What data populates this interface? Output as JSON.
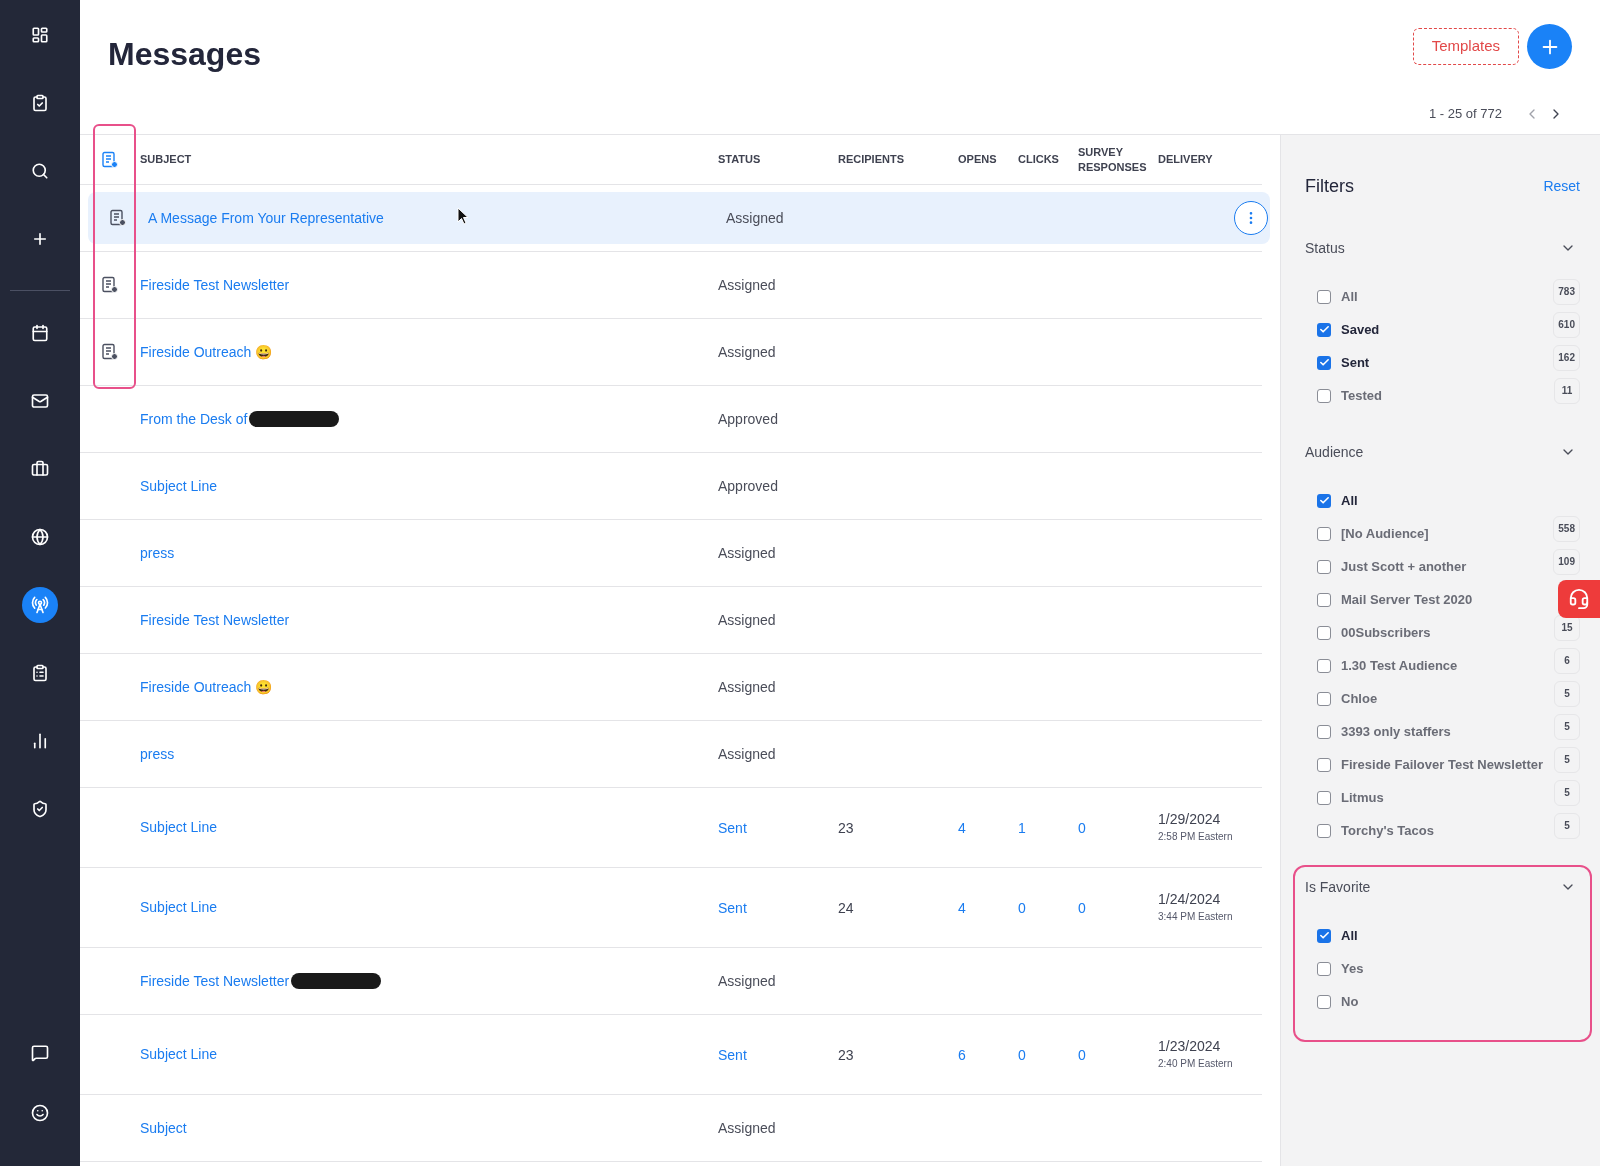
{
  "nav": [
    {
      "selected": false
    },
    {
      "selected": false
    },
    {
      "selected": false
    },
    {
      "selected": false
    },
    {
      "selected": false
    },
    {
      "selected": false
    },
    {
      "selected": false
    },
    {
      "selected": false
    },
    {
      "selected": true
    },
    {
      "selected": false
    },
    {
      "selected": false
    },
    {
      "selected": false
    },
    {
      "selected": false
    },
    {
      "selected": false
    }
  ],
  "header": {
    "title": "Messages",
    "templates_button": "Templates",
    "pagination": "1 - 25 of 772"
  },
  "table": {
    "columns": [
      "SUBJECT",
      "STATUS",
      "RECIPIENTS",
      "OPENS",
      "CLICKS",
      "SURVEY RESPONSES",
      "DELIVERY"
    ],
    "rows": [
      {
        "icon": true,
        "highlighted": true,
        "subject": "A Message From Your Representative",
        "redacted": false,
        "status": "Assigned",
        "kind": "text"
      },
      {
        "icon": true,
        "highlighted": false,
        "subject": "Fireside Test Newsletter",
        "redacted": false,
        "status": "Assigned",
        "kind": "text"
      },
      {
        "icon": true,
        "highlighted": false,
        "subject": "Fireside Outreach 😀",
        "redacted": false,
        "status": "Assigned",
        "kind": "text"
      },
      {
        "icon": false,
        "highlighted": false,
        "subject": "From the Desk of",
        "redacted": true,
        "status": "Approved",
        "kind": "text"
      },
      {
        "icon": false,
        "highlighted": false,
        "subject": "Subject Line",
        "redacted": false,
        "status": "Approved",
        "kind": "text"
      },
      {
        "icon": false,
        "highlighted": false,
        "subject": "press",
        "redacted": false,
        "status": "Assigned",
        "kind": "text"
      },
      {
        "icon": false,
        "highlighted": false,
        "subject": "Fireside Test Newsletter",
        "redacted": false,
        "status": "Assigned",
        "kind": "text"
      },
      {
        "icon": false,
        "highlighted": false,
        "subject": "Fireside Outreach 😀",
        "redacted": false,
        "status": "Assigned",
        "kind": "text"
      },
      {
        "icon": false,
        "highlighted": false,
        "subject": "press",
        "redacted": false,
        "status": "Assigned",
        "kind": "text"
      },
      {
        "icon": false,
        "highlighted": false,
        "subject": "Subject Line",
        "redacted": false,
        "status": "Sent",
        "kind": "link",
        "recipients": "23",
        "opens": "4",
        "clicks": "1",
        "survey_responses": "0",
        "delivery_date": "1/29/2024",
        "delivery_time": "2:58 PM Eastern"
      },
      {
        "icon": false,
        "highlighted": false,
        "subject": "Subject Line",
        "redacted": false,
        "status": "Sent",
        "kind": "link",
        "recipients": "24",
        "opens": "4",
        "clicks": "0",
        "survey_responses": "0",
        "delivery_date": "1/24/2024",
        "delivery_time": "3:44 PM Eastern"
      },
      {
        "icon": false,
        "highlighted": false,
        "subject": "Fireside Test Newsletter",
        "redacted": true,
        "status": "Assigned",
        "kind": "text"
      },
      {
        "icon": false,
        "highlighted": false,
        "subject": "Subject Line",
        "redacted": false,
        "status": "Sent",
        "kind": "link",
        "recipients": "23",
        "opens": "6",
        "clicks": "0",
        "survey_responses": "0",
        "delivery_date": "1/23/2024",
        "delivery_time": "2:40 PM Eastern"
      },
      {
        "icon": false,
        "highlighted": false,
        "subject": "Subject",
        "redacted": false,
        "status": "Assigned",
        "kind": "text"
      }
    ]
  },
  "filters": {
    "title": "Filters",
    "reset": "Reset",
    "groups": [
      {
        "title": "Status",
        "expanded": true,
        "highlighted": false,
        "options": [
          {
            "label": "All",
            "checked": false,
            "count": "783"
          },
          {
            "label": "Saved",
            "checked": true,
            "count": "610"
          },
          {
            "label": "Sent",
            "checked": true,
            "count": "162"
          },
          {
            "label": "Tested",
            "checked": false,
            "count": "11"
          }
        ]
      },
      {
        "title": "Audience",
        "expanded": true,
        "highlighted": false,
        "options": [
          {
            "label": "All",
            "checked": true
          },
          {
            "label": "[No Audience]",
            "checked": false,
            "count": "558"
          },
          {
            "label": "Just Scott + another",
            "checked": false,
            "count": "109"
          },
          {
            "label": "Mail Server Test 2020",
            "checked": false
          },
          {
            "label": "00Subscribers",
            "checked": false,
            "count": "15"
          },
          {
            "label": "1.30 Test Audience",
            "checked": false,
            "count": "6"
          },
          {
            "label": "Chloe",
            "checked": false,
            "count": "5"
          },
          {
            "label": "3393 only staffers",
            "checked": false,
            "count": "5"
          },
          {
            "label": "Fireside Failover Test Newsletter",
            "checked": false,
            "count": "5"
          },
          {
            "label": "Litmus",
            "checked": false,
            "count": "5"
          },
          {
            "label": "Torchy's Tacos",
            "checked": false,
            "count": "5"
          }
        ]
      },
      {
        "title": "Is Favorite",
        "expanded": true,
        "highlighted": true,
        "options": [
          {
            "label": "All",
            "checked": true
          },
          {
            "label": "Yes",
            "checked": false
          },
          {
            "label": "No",
            "checked": false
          }
        ]
      }
    ]
  }
}
